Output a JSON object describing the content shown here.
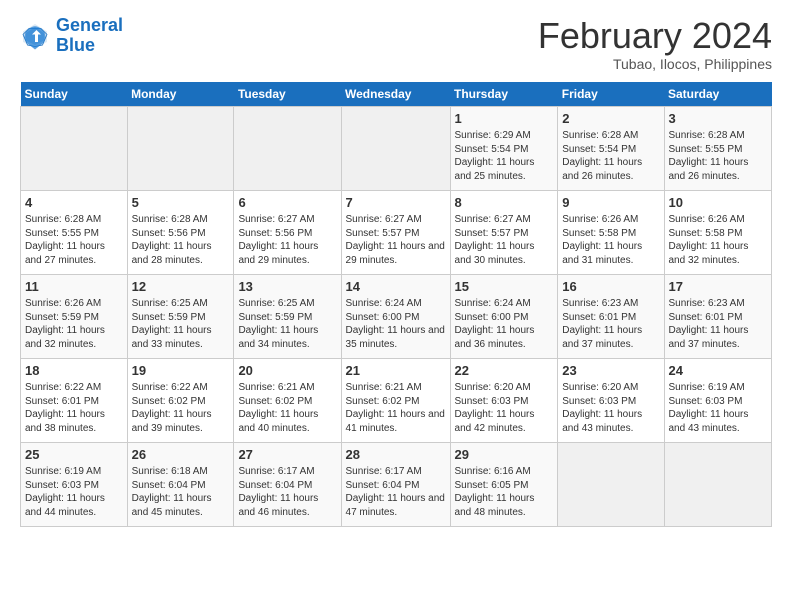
{
  "logo": {
    "line1": "General",
    "line2": "Blue"
  },
  "title": "February 2024",
  "location": "Tubao, Ilocos, Philippines",
  "days_of_week": [
    "Sunday",
    "Monday",
    "Tuesday",
    "Wednesday",
    "Thursday",
    "Friday",
    "Saturday"
  ],
  "weeks": [
    [
      {
        "day": "",
        "info": ""
      },
      {
        "day": "",
        "info": ""
      },
      {
        "day": "",
        "info": ""
      },
      {
        "day": "",
        "info": ""
      },
      {
        "day": "1",
        "info": "Sunrise: 6:29 AM\nSunset: 5:54 PM\nDaylight: 11 hours and 25 minutes."
      },
      {
        "day": "2",
        "info": "Sunrise: 6:28 AM\nSunset: 5:54 PM\nDaylight: 11 hours and 26 minutes."
      },
      {
        "day": "3",
        "info": "Sunrise: 6:28 AM\nSunset: 5:55 PM\nDaylight: 11 hours and 26 minutes."
      }
    ],
    [
      {
        "day": "4",
        "info": "Sunrise: 6:28 AM\nSunset: 5:55 PM\nDaylight: 11 hours and 27 minutes."
      },
      {
        "day": "5",
        "info": "Sunrise: 6:28 AM\nSunset: 5:56 PM\nDaylight: 11 hours and 28 minutes."
      },
      {
        "day": "6",
        "info": "Sunrise: 6:27 AM\nSunset: 5:56 PM\nDaylight: 11 hours and 29 minutes."
      },
      {
        "day": "7",
        "info": "Sunrise: 6:27 AM\nSunset: 5:57 PM\nDaylight: 11 hours and 29 minutes."
      },
      {
        "day": "8",
        "info": "Sunrise: 6:27 AM\nSunset: 5:57 PM\nDaylight: 11 hours and 30 minutes."
      },
      {
        "day": "9",
        "info": "Sunrise: 6:26 AM\nSunset: 5:58 PM\nDaylight: 11 hours and 31 minutes."
      },
      {
        "day": "10",
        "info": "Sunrise: 6:26 AM\nSunset: 5:58 PM\nDaylight: 11 hours and 32 minutes."
      }
    ],
    [
      {
        "day": "11",
        "info": "Sunrise: 6:26 AM\nSunset: 5:59 PM\nDaylight: 11 hours and 32 minutes."
      },
      {
        "day": "12",
        "info": "Sunrise: 6:25 AM\nSunset: 5:59 PM\nDaylight: 11 hours and 33 minutes."
      },
      {
        "day": "13",
        "info": "Sunrise: 6:25 AM\nSunset: 5:59 PM\nDaylight: 11 hours and 34 minutes."
      },
      {
        "day": "14",
        "info": "Sunrise: 6:24 AM\nSunset: 6:00 PM\nDaylight: 11 hours and 35 minutes."
      },
      {
        "day": "15",
        "info": "Sunrise: 6:24 AM\nSunset: 6:00 PM\nDaylight: 11 hours and 36 minutes."
      },
      {
        "day": "16",
        "info": "Sunrise: 6:23 AM\nSunset: 6:01 PM\nDaylight: 11 hours and 37 minutes."
      },
      {
        "day": "17",
        "info": "Sunrise: 6:23 AM\nSunset: 6:01 PM\nDaylight: 11 hours and 37 minutes."
      }
    ],
    [
      {
        "day": "18",
        "info": "Sunrise: 6:22 AM\nSunset: 6:01 PM\nDaylight: 11 hours and 38 minutes."
      },
      {
        "day": "19",
        "info": "Sunrise: 6:22 AM\nSunset: 6:02 PM\nDaylight: 11 hours and 39 minutes."
      },
      {
        "day": "20",
        "info": "Sunrise: 6:21 AM\nSunset: 6:02 PM\nDaylight: 11 hours and 40 minutes."
      },
      {
        "day": "21",
        "info": "Sunrise: 6:21 AM\nSunset: 6:02 PM\nDaylight: 11 hours and 41 minutes."
      },
      {
        "day": "22",
        "info": "Sunrise: 6:20 AM\nSunset: 6:03 PM\nDaylight: 11 hours and 42 minutes."
      },
      {
        "day": "23",
        "info": "Sunrise: 6:20 AM\nSunset: 6:03 PM\nDaylight: 11 hours and 43 minutes."
      },
      {
        "day": "24",
        "info": "Sunrise: 6:19 AM\nSunset: 6:03 PM\nDaylight: 11 hours and 43 minutes."
      }
    ],
    [
      {
        "day": "25",
        "info": "Sunrise: 6:19 AM\nSunset: 6:03 PM\nDaylight: 11 hours and 44 minutes."
      },
      {
        "day": "26",
        "info": "Sunrise: 6:18 AM\nSunset: 6:04 PM\nDaylight: 11 hours and 45 minutes."
      },
      {
        "day": "27",
        "info": "Sunrise: 6:17 AM\nSunset: 6:04 PM\nDaylight: 11 hours and 46 minutes."
      },
      {
        "day": "28",
        "info": "Sunrise: 6:17 AM\nSunset: 6:04 PM\nDaylight: 11 hours and 47 minutes."
      },
      {
        "day": "29",
        "info": "Sunrise: 6:16 AM\nSunset: 6:05 PM\nDaylight: 11 hours and 48 minutes."
      },
      {
        "day": "",
        "info": ""
      },
      {
        "day": "",
        "info": ""
      }
    ]
  ]
}
